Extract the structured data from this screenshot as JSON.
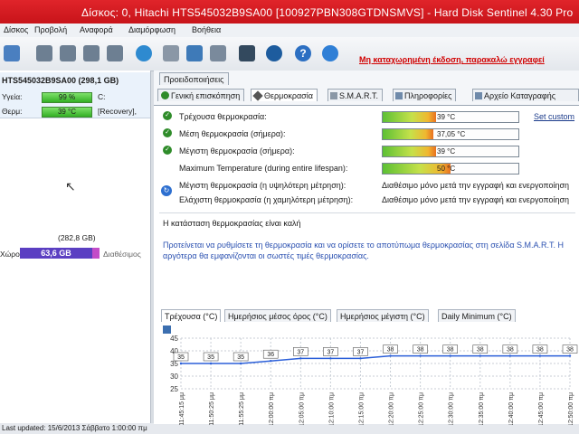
{
  "window": {
    "title": "Δίσκος: 0, Hitachi HTS545032B9SA00 [100927PBN308GTDNSMVS] - Hard Disk Sentinel 4.30 Pro"
  },
  "menu": {
    "items": [
      "Δίσκος",
      "Προβολή",
      "Αναφορά",
      "Διαμόρφωση",
      "Βοήθεια"
    ]
  },
  "toolbar": {
    "unregistered": "Μη καταχωρημένη έκδοση, παρακαλώ εγγραφεί"
  },
  "left": {
    "disk_name": "HTS545032B9SA00 (298,1 GB)",
    "health_label": "Υγεία:",
    "health_value": "99 %",
    "health_extra": "C:",
    "temp_label": "Θερμ:",
    "temp_value": "39 °C",
    "temp_extra": "[Recovery],",
    "volume_size": "(282,8 GB)",
    "volume_label": "Χώρος",
    "volume_free": "63,6 GB",
    "volume_free_label": "Διαθέσιμος"
  },
  "status": {
    "last_updated": "Last updated: 15/6/2013 Σάββατο 1:00:00 πμ"
  },
  "tabs": {
    "top": "Προειδοποιήσεις",
    "overview": "Γενική επισκόπηση",
    "temperature": "Θερμοκρασία",
    "smart": "S.M.A.R.T.",
    "info": "Πληροφορίες",
    "log": "Αρχείο Καταγραφής"
  },
  "temps": {
    "current_label": "Τρέχουσα θερμοκρασία:",
    "current_value": "39 °C",
    "current_level": 0.39,
    "avg_label": "Μέση θερμοκρασία (σήμερα):",
    "avg_value": "37,05 °C",
    "avg_level": 0.37,
    "max_label": "Μέγιστη θερμοκρασία (σήμερα):",
    "max_value": "39 °C",
    "max_level": 0.39,
    "lifespan_label": "Maximum Temperature (during entire lifespan):",
    "lifespan_value": "50 °C",
    "lifespan_level": 0.5,
    "max_measure_label": "Μέγιστη θερμοκρασία (η υψηλότερη μέτρηση):",
    "max_measure_value": "Διαθέσιμο μόνο μετά την εγγραφή και ενεργοποίηση",
    "min_measure_label": "Ελάχιστη θερμοκρασία (η χαμηλότερη μέτρηση):",
    "min_measure_value": "Διαθέσιμο μόνο μετά την εγγραφή και ενεργοποίηση",
    "set_custom": "Set custom"
  },
  "status_text": "Η κατάσταση θερμοκρασίας είναι καλή",
  "advice": "Προτείνεται να ρυθμίσετε τη θερμοκρασία και να ορίσετε το αποτύπωμα θερμοκρασίας στη σελίδα S.M.A.R.T. Η αργότερα θα εμφανίζονται οι σωστές τιμές θερμοκρασίας.",
  "chart_tabs": [
    "Τρέχουσα (°C)",
    "Ημερήσιος μέσος όρος (°C)",
    "Ημερήσιος μέγιστη (°C)",
    "Daily Minimum (°C)"
  ],
  "colors": {
    "title": "#d0181e",
    "line": "#2b5fd9",
    "health": "#3cb82a",
    "volume": "#5b3fc2"
  },
  "chart_data": {
    "type": "line",
    "x": [
      "11:45:15 μμ",
      "11:50:25 μμ",
      "11:55:25 μμ",
      "12:00:00 πμ",
      "12:05:00 πμ",
      "12:10:00 πμ",
      "12:15:00 πμ",
      "12:20:00 πμ",
      "12:25:00 πμ",
      "12:30:00 πμ",
      "12:35:00 πμ",
      "12:40:00 πμ",
      "12:45:00 πμ",
      "12:50:00 πμ"
    ],
    "series": [
      {
        "values": [
          35,
          35,
          35,
          36,
          37,
          37,
          37,
          38,
          38,
          38,
          38,
          38,
          38,
          38
        ]
      }
    ],
    "ylim": [
      25,
      45
    ],
    "yticks": [
      25,
      30,
      35,
      40,
      45
    ],
    "grid": true
  }
}
